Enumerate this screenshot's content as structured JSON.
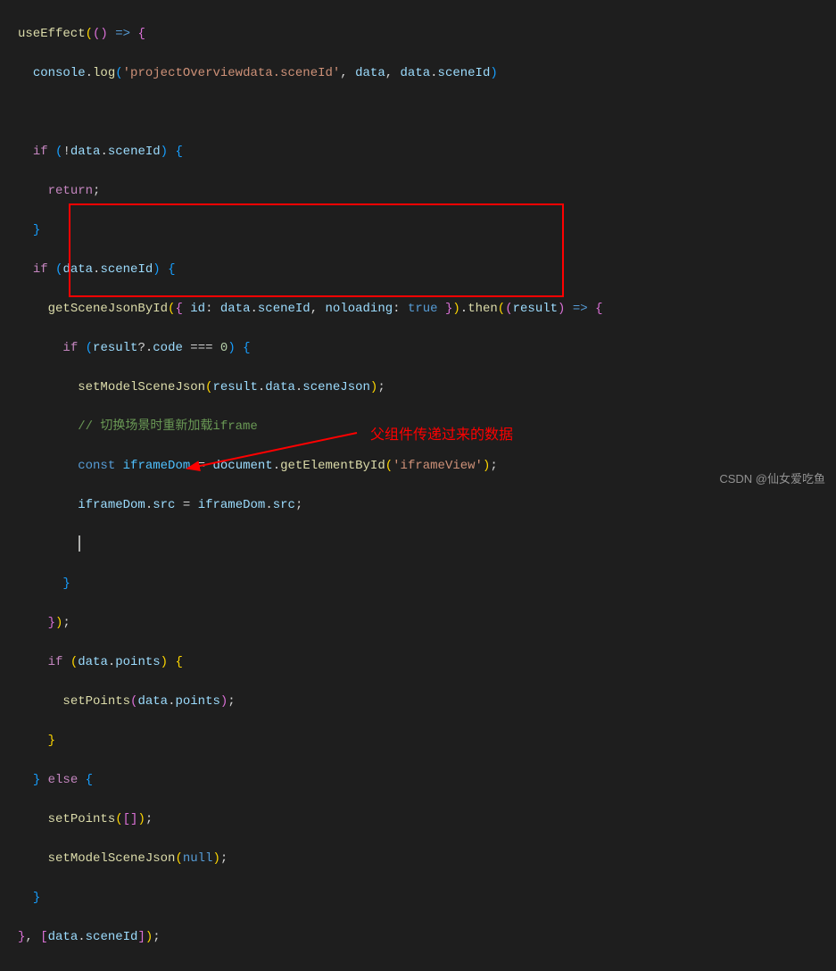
{
  "code": {
    "l1_useEffect": "useEffect",
    "l1_arrow": "(() ",
    "l1_arrow2": "=>",
    "l1_brace": " {",
    "l2_console": "console",
    "l2_log": "log",
    "l2_str": "'projectOverviewdata.sceneId'",
    "l2_data": "data",
    "l2_sceneId": "sceneId",
    "l4_if": "if",
    "l4_data": "data",
    "l4_sceneId": "sceneId",
    "l5_return": "return",
    "l7_if": "if",
    "l7_data": "data",
    "l7_sceneId": "sceneId",
    "l8_func": "getSceneJsonById",
    "l8_id": "id",
    "l8_data": "data",
    "l8_sceneId": "sceneId",
    "l8_noloading": "noloading",
    "l8_true": "true",
    "l8_then": "then",
    "l8_result": "result",
    "l9_if": "if",
    "l9_result": "result",
    "l9_code": "code",
    "l9_zero": "0",
    "l10_func": "setModelSceneJson",
    "l10_result": "result",
    "l10_data": "data",
    "l10_sceneJson": "sceneJson",
    "l11_comment": "// 切换场景时重新加载iframe",
    "l12_const": "const",
    "l12_var": "iframeDom",
    "l12_doc": "document",
    "l12_getEl": "getElementById",
    "l12_str": "'iframeView'",
    "l13_var": "iframeDom",
    "l13_src": "src",
    "l13_var2": "iframeDom",
    "l13_src2": "src",
    "l17_if": "if",
    "l17_data": "data",
    "l17_points": "points",
    "l18_func": "setPoints",
    "l18_data": "data",
    "l18_points": "points",
    "l20_else": "else",
    "l21_func": "setPoints",
    "l22_func": "setModelSceneJson",
    "l22_null": "null",
    "l24_data": "data",
    "l24_sceneId": "sceneId"
  },
  "annotation": {
    "text": "父组件传递过来的数据"
  },
  "watermark": "CSDN @仙女爱吃鱼"
}
